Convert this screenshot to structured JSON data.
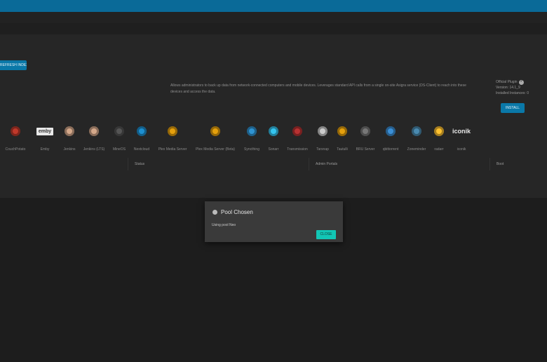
{
  "toolbar": {
    "refresh_label": "REFRESH INDEX"
  },
  "plugin_detail": {
    "description": "Allows administrators to back up data from network-connected computers and mobile devices. Leverages standard API calls from a single on-site Asigra service (DS-Client) to reach into these devices and access the data.",
    "official": "Official Plugin",
    "version": "Version: 14.1_9",
    "installed": "Installed Instances: 0",
    "install_label": "INSTALL"
  },
  "plugins": [
    {
      "label": "CouchPotato",
      "icon": "couchpotato-icon",
      "color": "#c0392b"
    },
    {
      "label": "Emby",
      "icon": "emby-icon",
      "color": "#e8e8e8"
    },
    {
      "label": "Jenkins",
      "icon": "jenkins-icon",
      "color": "#d4a88a"
    },
    {
      "label": "Jenkins (LTS)",
      "icon": "jenkins-icon",
      "color": "#d4a88a"
    },
    {
      "label": "MineOS",
      "icon": "mineos-icon",
      "color": "#555555"
    },
    {
      "label": "Nextcloud",
      "icon": "nextcloud-icon",
      "color": "#1d8fd0"
    },
    {
      "label": "Plex Media Server",
      "icon": "plex-icon",
      "color": "#e5a00d"
    },
    {
      "label": "Plex Media Server (Beta)",
      "icon": "plex-icon",
      "color": "#e5a00d"
    },
    {
      "label": "Syncthing",
      "icon": "syncthing-icon",
      "color": "#2f93d1"
    },
    {
      "label": "Sonarr",
      "icon": "sonarr-icon",
      "color": "#35c5f0"
    },
    {
      "label": "Transmission",
      "icon": "transmission-icon",
      "color": "#b83232"
    },
    {
      "label": "Tarsnap",
      "icon": "tarsnap-icon",
      "color": "#cccccc"
    },
    {
      "label": "Tautulli",
      "icon": "tautulli-icon",
      "color": "#e5a00d"
    },
    {
      "label": "BRU Server",
      "icon": "bru-server-icon",
      "color": "#777777"
    },
    {
      "label": "qbittorrent",
      "icon": "qbittorrent-icon",
      "color": "#3b8fd6"
    },
    {
      "label": "Zoneminder",
      "icon": "zoneminder-icon",
      "color": "#4a8ab0"
    },
    {
      "label": "radarr",
      "icon": "radarr-icon",
      "color": "#ffc230"
    },
    {
      "label": "iconik",
      "icon": "iconik-icon",
      "color": "#e8e8e8"
    }
  ],
  "emby_logo_text": "emby",
  "iconik_logo_text": "iconik",
  "table": {
    "status_header": "Status",
    "portals_header": "Admin Portals",
    "boot_header": "Boot"
  },
  "dialog": {
    "title": "Pool Chosen",
    "message": "Using pool Neo",
    "close_label": "CLOSE"
  },
  "colors": {
    "topbar": "#0a6a98",
    "accent": "#0a78a8",
    "dialog_button": "#12c6b5"
  }
}
